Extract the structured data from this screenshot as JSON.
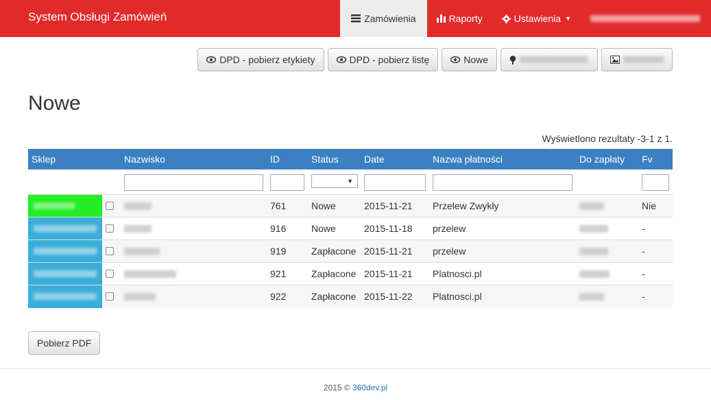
{
  "navbar": {
    "brand": "System Obsługi Zamówień",
    "items": [
      {
        "label": "Zamówienia",
        "icon": "list-icon",
        "active": true
      },
      {
        "label": "Raporty",
        "icon": "bar-chart-icon"
      },
      {
        "label": "Ustawienia",
        "icon": "gear-icon"
      }
    ]
  },
  "toolbar": {
    "buttons": [
      {
        "label": "DPD - pobierz etykiety",
        "icon": "eye-icon"
      },
      {
        "label": "DPD - pobierz listę",
        "icon": "eye-icon"
      },
      {
        "label": "Nowe",
        "icon": "eye-icon"
      },
      {
        "label": "",
        "icon": "tree-icon"
      },
      {
        "label": "",
        "icon": "picture-icon"
      }
    ]
  },
  "page": {
    "title": "Nowe",
    "results": "Wyświetlono rezultaty -3-1 z 1."
  },
  "table": {
    "columns": [
      "Sklep",
      "Nazwisko",
      "ID",
      "Status",
      "Date",
      "Nazwa płatności",
      "Do zapłaty",
      "Fv"
    ],
    "rows": [
      {
        "shop_color": "#22ee22",
        "id": "761",
        "status": "Nowe",
        "date": "2015-11-21",
        "payment": "Przelew Zwykły",
        "fv": "Nie"
      },
      {
        "shop_color": "#3aaed8",
        "id": "916",
        "status": "Nowe",
        "date": "2015-11-18",
        "payment": "przelew",
        "fv": "-"
      },
      {
        "shop_color": "#3aaed8",
        "id": "919",
        "status": "Zapłacone",
        "date": "2015-11-21",
        "payment": "przelew",
        "fv": "-"
      },
      {
        "shop_color": "#3aaed8",
        "id": "921",
        "status": "Zapłacone",
        "date": "2015-11-21",
        "payment": "Platnosci.pl",
        "fv": "-"
      },
      {
        "shop_color": "#3aaed8",
        "id": "922",
        "status": "Zapłacone",
        "date": "2015-11-22",
        "payment": "Platnosci.pl",
        "fv": "-"
      }
    ]
  },
  "pdf_button": "Pobierz PDF",
  "footer": {
    "text": "2015 ©",
    "link": "360dev.pl"
  },
  "colors": {
    "navbar": "#e12b2b",
    "table_header": "#3a80c2",
    "shop_green": "#22ee22",
    "shop_cyan": "#3aaed8"
  }
}
